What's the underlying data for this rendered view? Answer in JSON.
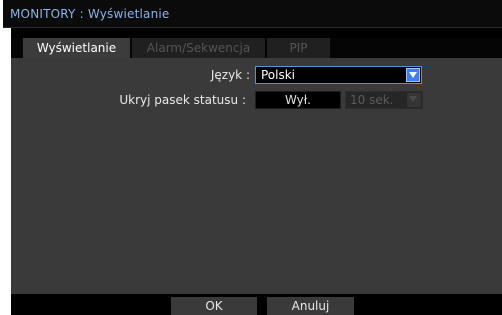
{
  "window": {
    "title": "MONITORY : Wyświetlanie"
  },
  "tabs": [
    {
      "label": "Wyświetlanie",
      "active": true
    },
    {
      "label": "Alarm/Sekwencja",
      "active": false
    },
    {
      "label": "PIP",
      "active": false
    }
  ],
  "settings": {
    "language": {
      "label": "Język :",
      "value": "Polski"
    },
    "hide_status_bar": {
      "label": "Ukryj pasek statusu :",
      "value": "Wył.",
      "timeout_value": "10 sek."
    }
  },
  "buttons": {
    "ok_label": "OK",
    "cancel_label": "Anuluj"
  },
  "colors": {
    "title_text": "#8ab4e8",
    "accent_border": "#5b8fd6",
    "dropdown_button": "#3d7ff0",
    "panel_background": "#3a3a3a",
    "disabled_text": "#545454"
  },
  "icons": {
    "language_dropdown": "chevron-down-icon",
    "timeout_dropdown": "chevron-down-icon"
  }
}
